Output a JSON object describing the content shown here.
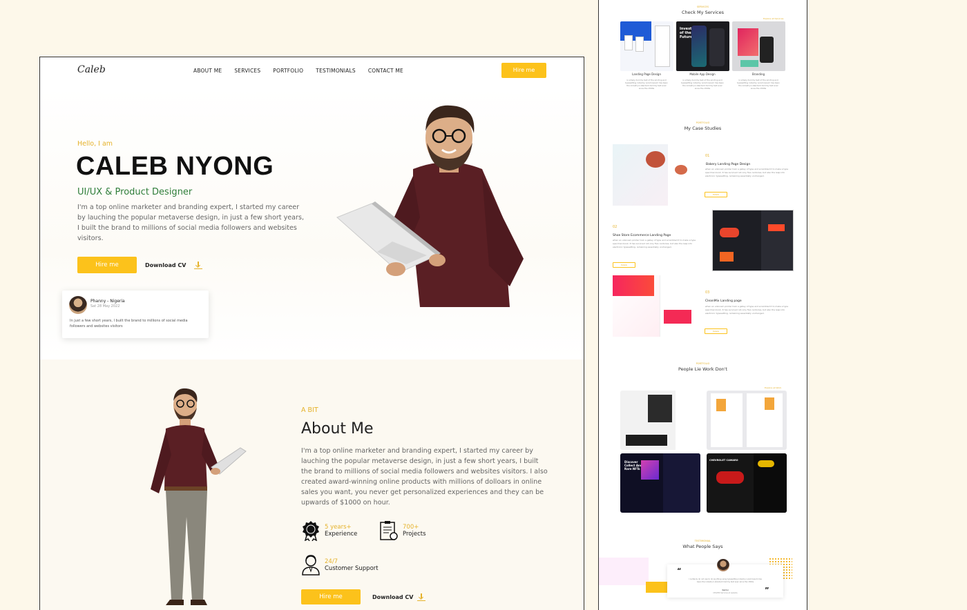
{
  "nav": {
    "logo": "Caleb",
    "items": [
      "ABOUT ME",
      "SERVICES",
      "PORTFOLIO",
      "TESTIMONIALS",
      "CONTACT ME"
    ],
    "hire_label": "Hire me"
  },
  "hero": {
    "greeting": "Hello, I am",
    "name": "CALEB NYONG",
    "role": "UI/UX & Product Designer",
    "bio": "I'm a top online marketer and branding expert, I started my career by lauching the popular metaverse design, in just a few short years, I built the brand to millions of social media followers and websites visitors.",
    "hire_label": "Hire me",
    "download_label": "Download CV"
  },
  "testimonial": {
    "name": "Phanny - Nigeria",
    "date": "Sat 28 May 2022",
    "text": "In just a few short years, I built the brand to millions of social media followers and websites visitors"
  },
  "about": {
    "kicker": "A BIT",
    "title": "About Me",
    "text": "I'm a top online marketer and branding expert, I started my career by lauching the popular metaverse design, in just a few short years, I built the brand to millions of social media followers and websites visitors. I also created award-winning online products with millions of dolloars in online sales you want, you never get personalized experiences and they can be upwards of $1000 on hour.",
    "stats": [
      {
        "num": "5 years+",
        "label": "Experience"
      },
      {
        "num": "700+",
        "label": "Projects"
      },
      {
        "num": "24/7",
        "label": "Customer Support"
      }
    ],
    "hire_label": "Hire me",
    "download_label": "Download CV"
  },
  "right": {
    "services_kicker": "SERVICES",
    "services_title": "Check My Services",
    "services_link": "Explore all Services",
    "services": [
      {
        "name": "Landing Page Design",
        "desc": "is simply dummy text of the printing and typesetting industry. Lorem Ipsum has been the industry's standard dummy text ever since the 1500s"
      },
      {
        "name": "Mobile App Design",
        "desc": "is simply dummy text of the printing and typesetting industry. Lorem Ipsum has been the industry's standard dummy text ever since the 1500s"
      },
      {
        "name": "Branding",
        "desc": "is simply dummy text of the printing and typesetting industry. Lorem Ipsum has been the industry's standard dummy text ever since the 1500s"
      }
    ],
    "cases_kicker": "PORTFOLIO",
    "cases_title": "My Case Studies",
    "cases": [
      {
        "num": "01",
        "title": "Bakery Landing Page Design",
        "desc": "when an unknown printer took a galley of type and scrambled it to make a type specimen book. It has survived not only five centuries, but also the leap into electronic typesetting, remaining essentially unchanged.",
        "btn": "Details"
      },
      {
        "num": "02",
        "title": "Shoe Store Ecommerce Landing Page",
        "desc": "when an unknown printer took a galley of type and scrambled it to make a type specimen book. It has survived not only five centuries, but also the leap into electronic typesetting, remaining essentially unchanged.",
        "btn": "Details"
      },
      {
        "num": "03",
        "title": "CleanMix Landing page",
        "desc": "when an unknown printer took a galley of type and scrambled it to make a type specimen book. It has survived not only five centuries, but also the leap into electronic typesetting, remaining essentially unchanged.",
        "btn": "Details"
      }
    ],
    "works_kicker": "PORTFOLIO",
    "works_title": "People Lie Work Don't",
    "works_link": "Explore all Work",
    "testi_kicker": "TESTIMONIAL",
    "testi_title": "What People Says",
    "testi_text": "I certainly do not use to do anything using typesetting industry. Lorem Ipsum has been the industry's standard dummy text ever since the 1500s",
    "testi_name": "Kamsi",
    "testi_role": "CEO/MD Services at website"
  }
}
